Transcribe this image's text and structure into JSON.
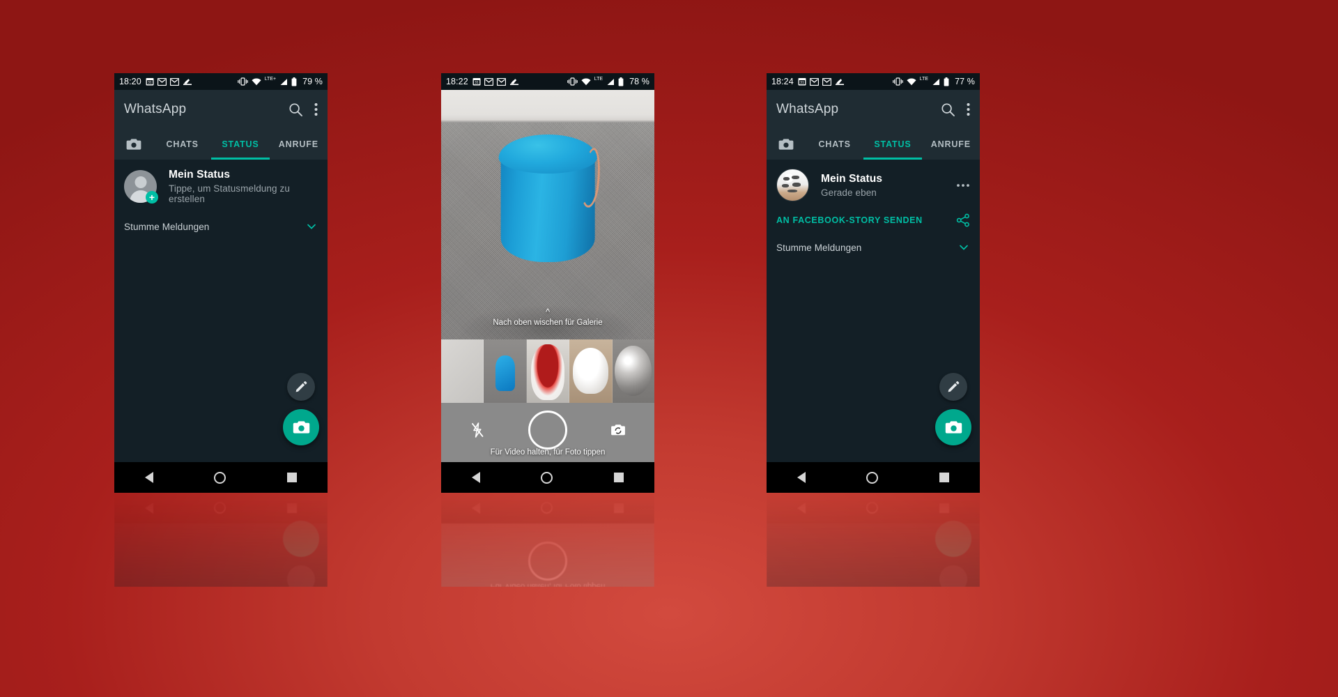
{
  "theme": {
    "background_red": "#a81f1c",
    "accent_teal": "#00bfa5",
    "appbar_bg": "#1f2c33",
    "screen_bg": "#131f26",
    "statusbar_bg": "#0b1419"
  },
  "phones": [
    {
      "id": "phone-status-empty",
      "statusbar": {
        "time": "18:20",
        "left_icons": [
          "calendar-icon",
          "gmail-icon",
          "gmail-icon",
          "shoe-icon"
        ],
        "right_icons": [
          "vibrate-icon",
          "wifi-icon",
          "signal-icon",
          "battery-icon"
        ],
        "network": "LTE+",
        "battery": "79 %"
      },
      "appbar": {
        "title": "WhatsApp",
        "actions": [
          "search-icon",
          "overflow-menu-icon"
        ]
      },
      "tabs": [
        {
          "label": "",
          "icon": "camera-icon",
          "active": false
        },
        {
          "label": "CHATS",
          "active": false
        },
        {
          "label": "STATUS",
          "active": true
        },
        {
          "label": "ANRUFE",
          "active": false
        }
      ],
      "status_entry": {
        "avatar": "default-person-avatar",
        "badge": "+",
        "title": "Mein Status",
        "subtitle": "Tippe, um Statusmeldung zu erstellen"
      },
      "facebook_story": null,
      "muted_section": {
        "label": "Stumme Meldungen",
        "chevron": "chevron-down-icon"
      },
      "fabs": {
        "secondary": "pencil-icon",
        "primary": "camera-icon"
      },
      "navbar": [
        "back-icon",
        "home-icon",
        "recents-icon"
      ]
    },
    {
      "id": "phone-camera",
      "statusbar": {
        "time": "18:22",
        "left_icons": [
          "calendar-icon",
          "gmail-icon",
          "gmail-icon",
          "shoe-icon"
        ],
        "right_icons": [
          "vibrate-icon",
          "wifi-icon",
          "signal-icon",
          "battery-icon"
        ],
        "network": "LTE",
        "battery": "78 %"
      },
      "camera": {
        "hint_top": "Nach oben wischen für Galerie",
        "chevron_up": "chevron-up-icon",
        "hint_bottom": "Für Video halten, für Foto tippen",
        "shutter": "shutter-button",
        "flash": "flash-off-icon",
        "flip": "flip-camera-icon",
        "gallery_thumbnails": [
          "carpet-thumbnail",
          "blue-stool-thumbnail",
          "red-chair-thumbnail",
          "white-helmet-thumbnail",
          "grey-ball-thumbnail"
        ]
      },
      "navbar": [
        "back-icon",
        "home-icon",
        "recents-icon"
      ]
    },
    {
      "id": "phone-status-posted",
      "statusbar": {
        "time": "18:24",
        "left_icons": [
          "calendar-icon",
          "gmail-icon",
          "gmail-icon",
          "shoe-icon"
        ],
        "right_icons": [
          "vibrate-icon",
          "wifi-icon",
          "signal-icon",
          "battery-icon"
        ],
        "network": "LTE",
        "battery": "77 %"
      },
      "appbar": {
        "title": "WhatsApp",
        "actions": [
          "search-icon",
          "overflow-menu-icon"
        ]
      },
      "tabs": [
        {
          "label": "",
          "icon": "camera-icon",
          "active": false
        },
        {
          "label": "CHATS",
          "active": false
        },
        {
          "label": "STATUS",
          "active": true
        },
        {
          "label": "ANRUFE",
          "active": false
        }
      ],
      "status_entry": {
        "avatar": "white-helmet-photo-avatar",
        "title": "Mein Status",
        "subtitle": "Gerade eben",
        "more": "more-horizontal-icon"
      },
      "facebook_story": {
        "label": "AN FACEBOOK-STORY SENDEN",
        "icon": "share-icon"
      },
      "muted_section": {
        "label": "Stumme Meldungen",
        "chevron": "chevron-down-icon"
      },
      "fabs": {
        "secondary": "pencil-icon",
        "primary": "camera-icon"
      },
      "navbar": [
        "back-icon",
        "home-icon",
        "recents-icon"
      ]
    }
  ]
}
